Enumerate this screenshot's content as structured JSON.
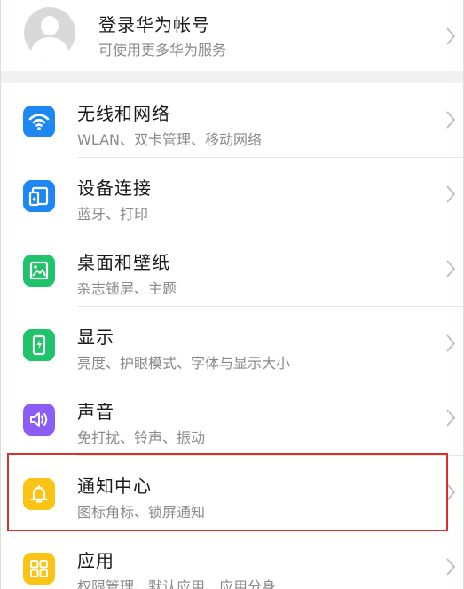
{
  "account": {
    "title": "登录华为帐号",
    "subtitle": "可使用更多华为服务"
  },
  "items": [
    {
      "title": "无线和网络",
      "subtitle": "WLAN、双卡管理、移动网络",
      "icon": "wifi-icon",
      "color": "#1e88f2"
    },
    {
      "title": "设备连接",
      "subtitle": "蓝牙、打印",
      "icon": "device-connection-icon",
      "color": "#1e88f2"
    },
    {
      "title": "桌面和壁纸",
      "subtitle": "杂志锁屏、主题",
      "icon": "wallpaper-icon",
      "color": "#1fc36a"
    },
    {
      "title": "显示",
      "subtitle": "亮度、护眼模式、字体与显示大小",
      "icon": "display-icon",
      "color": "#1fc36a"
    },
    {
      "title": "声音",
      "subtitle": "免打扰、铃声、振动",
      "icon": "speaker-icon",
      "color": "#8b5cf6"
    },
    {
      "title": "通知中心",
      "subtitle": "图标角标、锁屏通知",
      "icon": "bell-icon",
      "color": "#fbc313"
    },
    {
      "title": "应用",
      "subtitle": "权限管理、默认应用、应用分身",
      "icon": "apps-grid-icon",
      "color": "#fbc313"
    }
  ],
  "highlight": {
    "color": "#d9302a"
  }
}
